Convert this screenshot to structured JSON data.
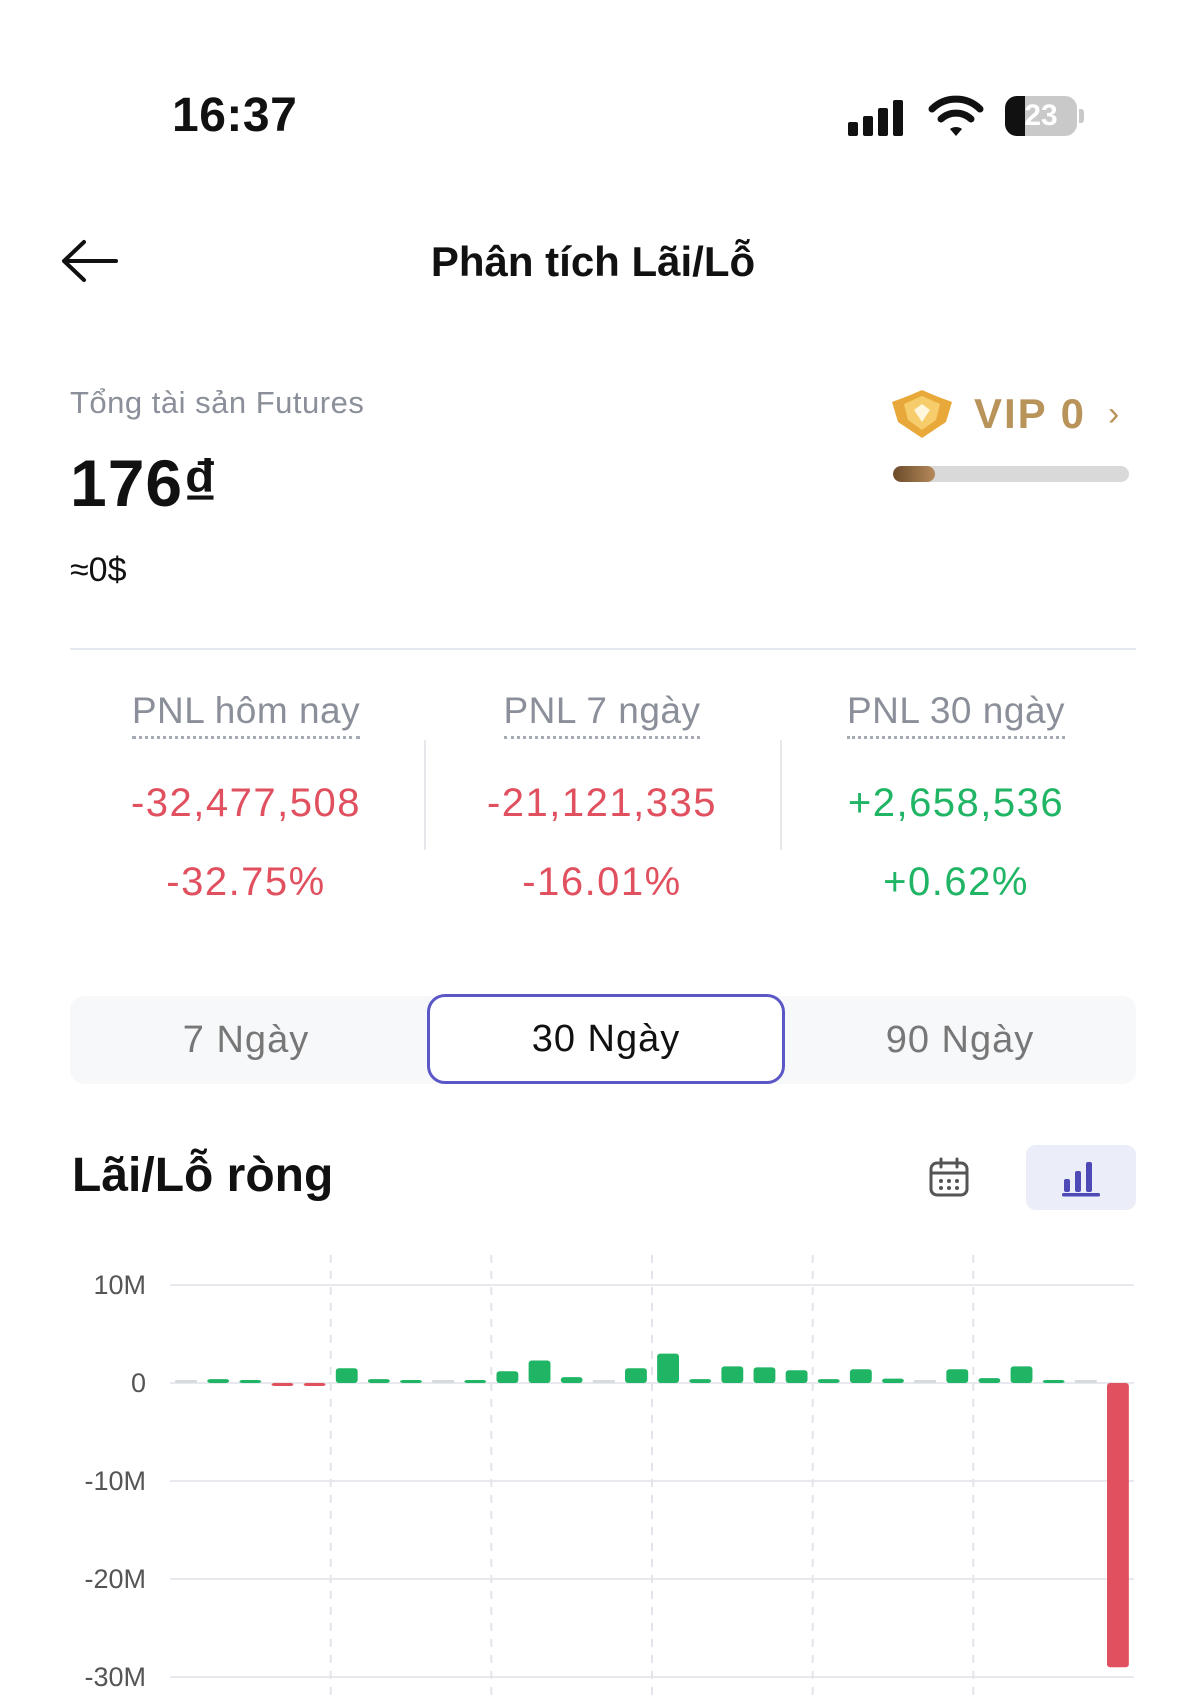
{
  "status_bar": {
    "time": "16:37",
    "battery": "23"
  },
  "header": {
    "title": "Phân tích Lãi/Lỗ"
  },
  "asset": {
    "label": "Tổng tài sản Futures",
    "value": "176₫",
    "approx": "≈0$"
  },
  "vip": {
    "label": "VIP 0",
    "progress": 0.18
  },
  "pnl": [
    {
      "label": "PNL hôm nay",
      "value": "-32,477,508",
      "percent": "-32.75%",
      "trend": "negative"
    },
    {
      "label": "PNL 7 ngày",
      "value": "-21,121,335",
      "percent": "-16.01%",
      "trend": "negative"
    },
    {
      "label": "PNL 30 ngày",
      "value": "+2,658,536",
      "percent": "+0.62%",
      "trend": "positive"
    }
  ],
  "tabs": [
    {
      "label": "7 Ngày",
      "active": false
    },
    {
      "label": "30 Ngày",
      "active": true
    },
    {
      "label": "90 Ngày",
      "active": false
    }
  ],
  "chart_section": {
    "title": "Lãi/Lỗ ròng",
    "icons": [
      "calendar-icon",
      "bar-chart-icon"
    ]
  },
  "colors": {
    "positive": "#1fb564",
    "negative": "#e0505f",
    "accent": "#5b57c7",
    "vip_gold": "#b8935a"
  },
  "chart_data": {
    "type": "bar",
    "ylim": [
      -30000000,
      10000000
    ],
    "yticks": [
      {
        "value": 10000000,
        "label": "10M"
      },
      {
        "value": 0,
        "label": "0"
      },
      {
        "value": -10000000,
        "label": "-10M"
      },
      {
        "value": -20000000,
        "label": "-20M"
      },
      {
        "value": -30000000,
        "label": "-30M"
      }
    ],
    "values": [
      0,
      400000,
      250000,
      -300000,
      -250000,
      1500000,
      400000,
      250000,
      0,
      250000,
      1200000,
      2300000,
      600000,
      0,
      1500000,
      3000000,
      400000,
      1700000,
      1600000,
      1300000,
      400000,
      1400000,
      450000,
      0,
      1400000,
      500000,
      1700000,
      250000,
      0,
      -29000000
    ]
  }
}
